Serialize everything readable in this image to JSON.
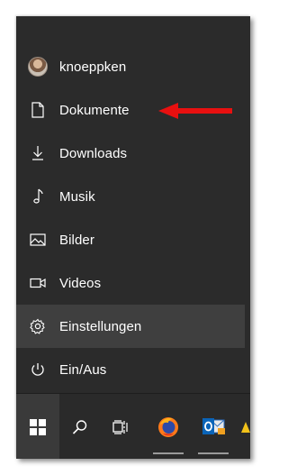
{
  "start_menu": {
    "items": [
      {
        "label": "knoeppken",
        "icon": "user-avatar"
      },
      {
        "label": "Dokumente",
        "icon": "document-icon"
      },
      {
        "label": "Downloads",
        "icon": "download-icon"
      },
      {
        "label": "Musik",
        "icon": "music-note-icon"
      },
      {
        "label": "Bilder",
        "icon": "pictures-icon"
      },
      {
        "label": "Videos",
        "icon": "video-icon"
      },
      {
        "label": "Einstellungen",
        "icon": "gear-icon"
      },
      {
        "label": "Ein/Aus",
        "icon": "power-icon"
      }
    ],
    "highlighted_item": "Einstellungen"
  },
  "annotation": {
    "arrow_color": "#e81010",
    "points_to": "Dokumente"
  },
  "taskbar": {
    "buttons": [
      "start-icon",
      "search-icon",
      "task-view-icon",
      "firefox-icon",
      "outlook-icon"
    ]
  },
  "colors": {
    "menu_background": "#2b2b2b",
    "hover_background": "#3f3f3f",
    "text": "#ffffff"
  }
}
